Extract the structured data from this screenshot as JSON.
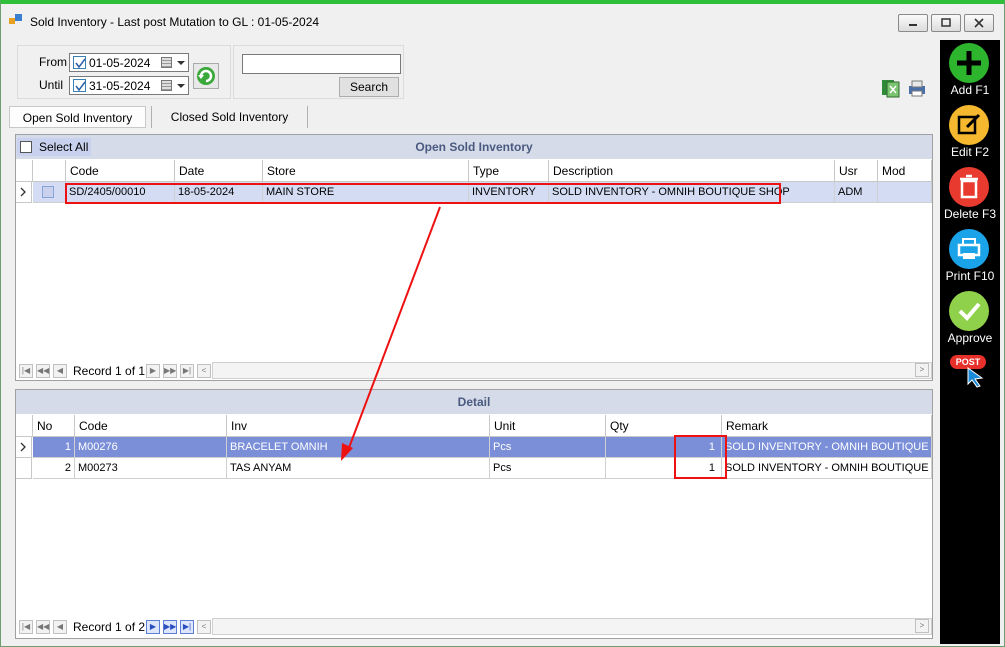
{
  "window": {
    "title": "Sold Inventory - Last post Mutation to GL : 01-05-2024"
  },
  "filter": {
    "from_label": "From",
    "from_value": "01-05-2024",
    "until_label": "Until",
    "until_value": "31-05-2024",
    "search_value": "",
    "search_button": "Search"
  },
  "tabs": [
    {
      "label": "Open Sold Inventory",
      "active": true
    },
    {
      "label": "Closed Sold Inventory",
      "active": false
    }
  ],
  "open_grid": {
    "title": "Open Sold Inventory",
    "select_all": "Select All",
    "columns": [
      "Code",
      "Date",
      "Store",
      "Type",
      "Description",
      "Usr",
      "Mod"
    ],
    "rows": [
      {
        "code": "SD/2405/00010",
        "date": "18-05-2024",
        "store": "MAIN STORE",
        "type": "INVENTORY",
        "description": "SOLD INVENTORY - OMNIH BOUTIQUE SHOP",
        "usr": "ADM",
        "mod": ""
      }
    ],
    "record_text": "Record 1 of 1"
  },
  "detail_grid": {
    "title": "Detail",
    "columns": [
      "No",
      "Code",
      "Inv",
      "Unit",
      "Qty",
      "Remark"
    ],
    "rows": [
      {
        "no": "1",
        "code": "M00276",
        "inv": "BRACELET OMNIH",
        "unit": "Pcs",
        "qty": "1",
        "remark": "SOLD INVENTORY - OMNIH BOUTIQUE S..."
      },
      {
        "no": "2",
        "code": "M00273",
        "inv": "TAS ANYAM",
        "unit": "Pcs",
        "qty": "1",
        "remark": "SOLD INVENTORY - OMNIH BOUTIQUE S..."
      }
    ],
    "record_text": "Record 1 of 2"
  },
  "sidebar": {
    "add": "Add F1",
    "edit": "Edit F2",
    "delete": "Delete F3",
    "print": "Print F10",
    "approve": "Approve",
    "post": "POST"
  },
  "colors": {
    "add": "#2db52d",
    "edit": "#f5b82e",
    "delete": "#e83a2e",
    "print": "#1aa3e8",
    "approve": "#8fd14a",
    "annotation": "#e11111"
  }
}
